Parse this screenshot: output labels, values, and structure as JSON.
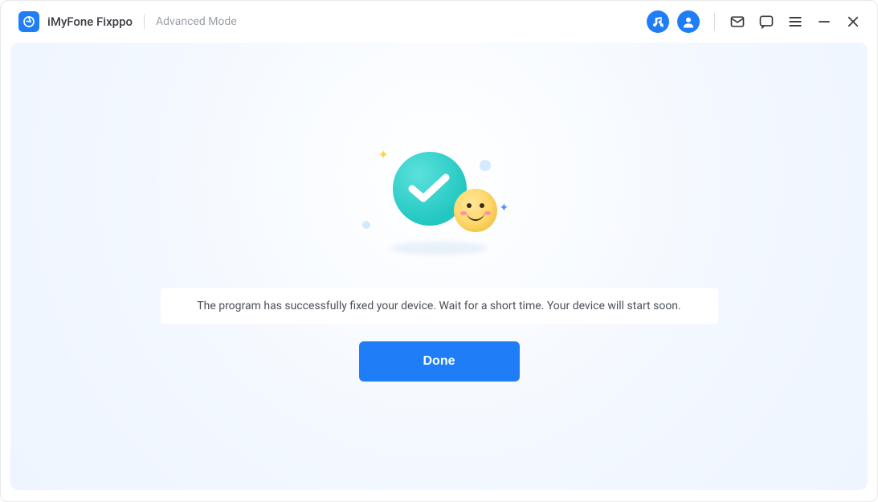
{
  "header": {
    "app_name": "iMyFone Fixppo",
    "mode": "Advanced Mode"
  },
  "icons": {
    "music": "music-icon",
    "account": "account-icon",
    "mail": "mail-icon",
    "feedback": "feedback-icon",
    "menu": "menu-icon",
    "minimize": "minimize-icon",
    "close": "close-icon"
  },
  "main": {
    "message": "The program has successfully fixed your device. Wait for a short time. Your device will start soon.",
    "done_label": "Done"
  },
  "colors": {
    "accent": "#1f7ef7",
    "check": "#22c7c0"
  }
}
